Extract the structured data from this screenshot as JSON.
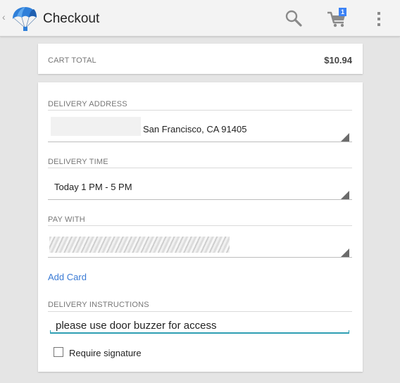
{
  "actionbar": {
    "title": "Checkout",
    "cart_count": "1",
    "icons": [
      "up-caret",
      "parachute-logo",
      "search-icon",
      "cart-icon",
      "overflow-menu-icon"
    ]
  },
  "cart_total": {
    "label": "CART TOTAL",
    "value": "$10.94"
  },
  "delivery_address": {
    "label": "DELIVERY ADDRESS",
    "value": "San Francisco, CA 91405"
  },
  "delivery_time": {
    "label": "DELIVERY TIME",
    "value": "Today 1 PM - 5 PM"
  },
  "pay_with": {
    "label": "PAY WITH",
    "add_card": "Add Card"
  },
  "delivery_instructions": {
    "label": "DELIVERY INSTRUCTIONS",
    "value": "please use door buzzer for access"
  },
  "signature": {
    "label": "Require signature",
    "checked": false
  },
  "colors": {
    "accent": "#2e9fb3",
    "link": "#3a7bd5",
    "badge": "#3b82f6",
    "background": "#e5e5e5"
  }
}
